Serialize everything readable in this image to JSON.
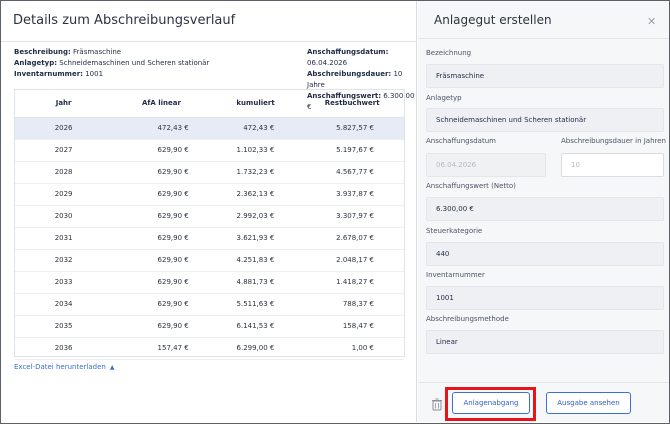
{
  "left_panel": {
    "title": "Details zum Abschreibungsverlauf",
    "meta_left": [
      {
        "label": "Beschreibung:",
        "value": "Fräsmaschine"
      },
      {
        "label": "Anlagetyp:",
        "value": "Schneidemaschinen und Scheren stationär"
      },
      {
        "label": "Inventarnummer:",
        "value": "1001"
      }
    ],
    "meta_right": [
      {
        "label": "Anschaffungsdatum:",
        "value": "06.04.2026"
      },
      {
        "label": "Abschreibungsdauer:",
        "value": "10 Jahre"
      },
      {
        "label": "Anschaffungswert:",
        "value": "6.300,00 €"
      }
    ],
    "table": {
      "headers": [
        "Jahr",
        "AfA linear",
        "kumuliert",
        "Restbuchwert"
      ],
      "rows": [
        [
          "2026",
          "472,43 €",
          "472,43 €",
          "5.827,57 €"
        ],
        [
          "2027",
          "629,90 €",
          "1.102,33 €",
          "5.197,67 €"
        ],
        [
          "2028",
          "629,90 €",
          "1.732,23 €",
          "4.567,77 €"
        ],
        [
          "2029",
          "629,90 €",
          "2.362,13 €",
          "3.937,87 €"
        ],
        [
          "2030",
          "629,90 €",
          "2.992,03 €",
          "3.307,97 €"
        ],
        [
          "2031",
          "629,90 €",
          "3.621,93 €",
          "2.678,07 €"
        ],
        [
          "2032",
          "629,90 €",
          "4.251,83 €",
          "2.048,17 €"
        ],
        [
          "2033",
          "629,90 €",
          "4.881,73 €",
          "1.418,27 €"
        ],
        [
          "2034",
          "629,90 €",
          "5.511,63 €",
          "788,37 €"
        ],
        [
          "2035",
          "629,90 €",
          "6.141,53 €",
          "158,47 €"
        ],
        [
          "2036",
          "157,47 €",
          "6.299,00 €",
          "1,00 €"
        ]
      ],
      "selected_row": 0
    },
    "excel_link": "Excel-Datei herunterladen"
  },
  "right_panel": {
    "title": "Anlagegut erstellen",
    "fields": {
      "bezeichnung": {
        "label": "Bezeichnung",
        "value": "Fräsmaschine"
      },
      "anlagetyp": {
        "label": "Anlagetyp",
        "value": "Schneidemaschinen und Scheren stationär"
      },
      "anschaffungsdatum": {
        "label": "Anschaffungsdatum",
        "value": "06.04.2026"
      },
      "abschreibungsdauer": {
        "label": "Abschreibungsdauer in Jahren",
        "value": "10"
      },
      "anschaffungswert": {
        "label": "Anschaffungswert (Netto)",
        "value": "6.300,00 €"
      },
      "steuerkategorie": {
        "label": "Steuerkategorie",
        "value": "440"
      },
      "inventarnummer": {
        "label": "Inventarnummer",
        "value": "1001"
      },
      "abschreibungsmethode": {
        "label": "Abschreibungsmethode",
        "value": "Linear"
      }
    },
    "buttons": {
      "anlagenabgang": "Anlagenabgang",
      "ausgabe": "Ausgabe ansehen"
    }
  },
  "colors": {
    "accent": "#3a6fd8",
    "highlight": "#e8141c",
    "selected_row": "#e6ebf6"
  }
}
